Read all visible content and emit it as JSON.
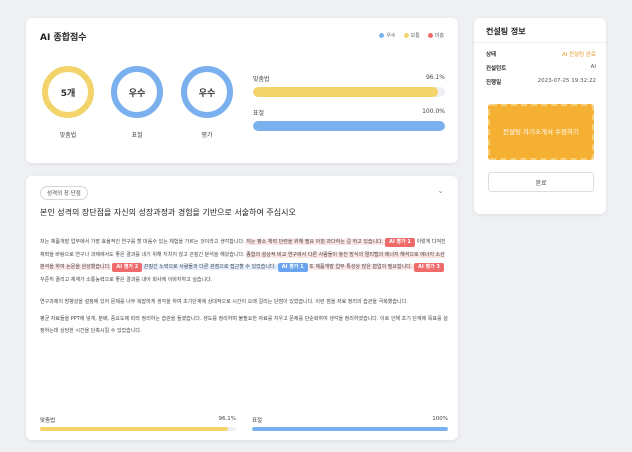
{
  "score": {
    "title": "AI 종합점수",
    "legend": [
      {
        "label": "우수",
        "color": "#7ab0ee"
      },
      {
        "label": "보통",
        "color": "#f2d46b"
      },
      {
        "label": "미흡",
        "color": "#ef6b6b"
      }
    ],
    "circles": [
      {
        "value": "5개",
        "label": "맞춤법",
        "color": "#f2d46b"
      },
      {
        "value": "우수",
        "label": "표절",
        "color": "#7ab0ee"
      },
      {
        "value": "우수",
        "label": "평가",
        "color": "#7ab0ee"
      }
    ],
    "bars": [
      {
        "label": "맞춤법",
        "value": "96.1%",
        "fraction": 0.961,
        "color": "#f2d46b"
      },
      {
        "label": "표절",
        "value": "100.0%",
        "fraction": 1.0,
        "color": "#7ab0ee"
      }
    ]
  },
  "consult": {
    "title": "컨설팅 정보",
    "rows": [
      {
        "key": "상태",
        "value": "AI 컨설팅 완료"
      },
      {
        "key": "컨설턴트",
        "value": "AI"
      },
      {
        "key": "진행일",
        "value": "2023-07-25 19:32:22"
      }
    ],
    "cta": "컨설팅 자기소개서 수정하기",
    "done": "완료"
  },
  "analysis": {
    "tag": "성격의 장·단점",
    "question": "본인 성격의 장단점을 자신의 성장과정과 경험을 기반으로 서술하여 주십시오",
    "para1": {
      "a": "저는 제품개발 업무에서 가장 효율적인 연구를 할 마음수 있는 체험을 가르는 것이라고 생각합니다. ",
      "b": "저는 평소 체력 단련을 위해 필요 아침 과다하는 걸 하고 있습니다. ",
      "badge1": "AI 평가 1",
      "c": " 이렇게 다져진 체력을 바탕으로 연구나 과제에서도 좋은 결과를 내기 위해 지치지 않고 끈질긴 분석을 해왔습니다. ",
      "d": "종합의 설상적 비교 연구에서 다른 사람들이 놓친 방식의 멀티탭의 에너지 해석으로 에너지 소산 분석을 하여 논문을 완성했습니다.",
      "badge2": "AI 평가 2",
      "e": " 끈질긴 노력으로 사람들과 다른 관점으로 접근할 수 있었습니다. ",
      "badge3": "AI 평가 1",
      "f": "또 제품개발 업무 특성상 많은 협업이 필요합니다. ",
      "badge4": "AI 평가 3",
      "g": " 꾸준히 끌리고 체계가 소통능력으로 좋은 결과를 내어 회사에 이바지하고 싶습니다."
    },
    "para2": "연구과제의 방향성을 설정에 있어 문제를 너무 복잡하게 생각을 하여 초기단계에 상대적으로 시간이 오래 걸리는 단점이 있었습니다. 이런 점을 자료 정리의 습관을 극복했습니다.",
    "para3": "평균 자료들을 PPT에 넣게, 분배, 중요도에 따라 정리하는 습관을 들였습니다. 생도를 정리하며 불필요한 자료를 지우고 문제를 단순화하여 생각을 정리하였습니다. 이로 인해 초기 단계에 목표를 설정하는데 상당한 시간을 단축시킬 수 있었습니다.",
    "bottom_bars": [
      {
        "label": "맞춤법",
        "value": "96.1%",
        "fraction": 0.961,
        "color": "#f2d46b"
      },
      {
        "label": "표절",
        "value": "100%",
        "fraction": 1.0,
        "color": "#7ab0ee"
      }
    ]
  }
}
